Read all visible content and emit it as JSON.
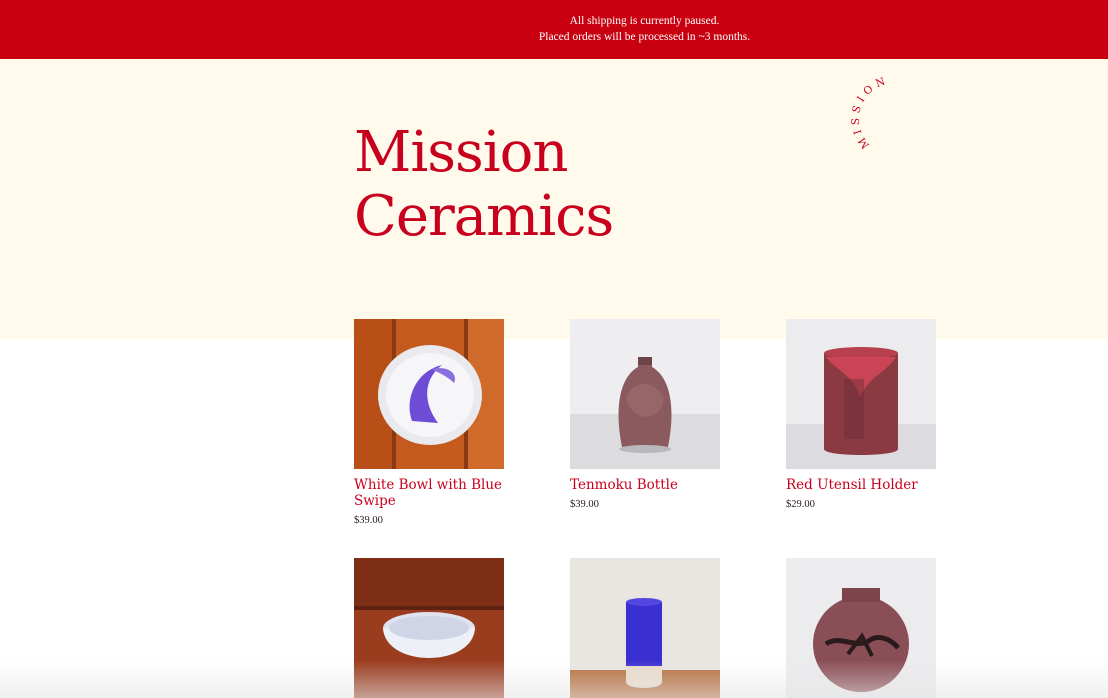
{
  "banner": {
    "line1": "All shipping is currently paused.",
    "line2": "Placed orders will be processed in ~3 months."
  },
  "header": {
    "title_line1": "Mission",
    "title_line2": "Ceramics",
    "logo_text": "MISSION CERAMICS"
  },
  "products": [
    {
      "name": "White Bowl with Blue Swipe",
      "price": "$39.00"
    },
    {
      "name": "Tenmoku Bottle",
      "price": "$39.00"
    },
    {
      "name": "Red Utensil Holder",
      "price": "$29.00"
    },
    {
      "name": "",
      "price": ""
    },
    {
      "name": "",
      "price": ""
    },
    {
      "name": "",
      "price": ""
    }
  ],
  "colors": {
    "brand_red": "#c8001e",
    "banner_red": "#c8000f",
    "hero_cream": "#fffaeb"
  }
}
